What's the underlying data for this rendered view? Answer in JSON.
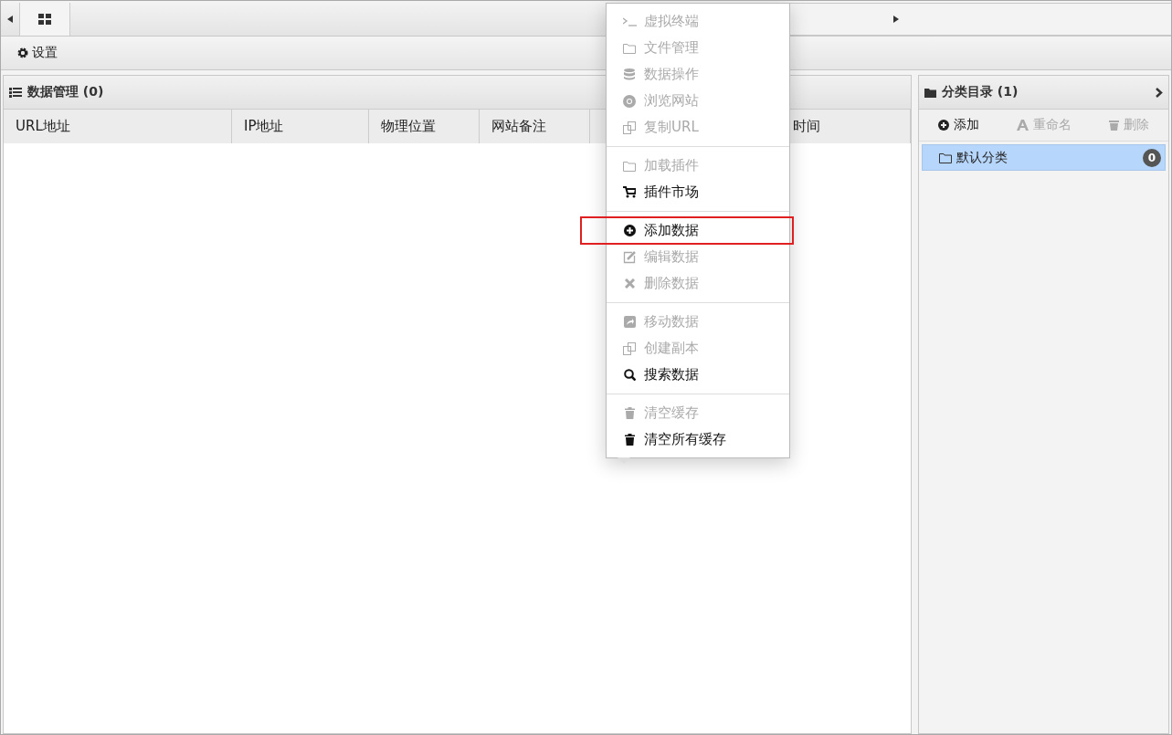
{
  "toolbar": {
    "settings_button": "设置"
  },
  "data_panel": {
    "title": "数据管理 (0)",
    "columns": [
      "URL地址",
      "IP地址",
      "物理位置",
      "网站备注",
      "时间"
    ]
  },
  "category_panel": {
    "title": "分类目录 (1)",
    "actions": [
      {
        "label": "添加",
        "disabled": false
      },
      {
        "label": "重命名",
        "disabled": true
      },
      {
        "label": "删除",
        "disabled": true
      }
    ],
    "items": [
      {
        "label": "默认分类",
        "count": "0",
        "selected": true
      }
    ]
  },
  "context_menu": [
    {
      "kind": "item",
      "label": "虚拟终端",
      "disabled": true,
      "highlighted": false
    },
    {
      "kind": "item",
      "label": "文件管理",
      "disabled": true,
      "highlighted": false
    },
    {
      "kind": "item",
      "label": "数据操作",
      "disabled": true,
      "highlighted": false
    },
    {
      "kind": "item",
      "label": "浏览网站",
      "disabled": true,
      "highlighted": false
    },
    {
      "kind": "item",
      "label": "复制URL",
      "disabled": true,
      "highlighted": false
    },
    {
      "kind": "separator"
    },
    {
      "kind": "item",
      "label": "加载插件",
      "disabled": true,
      "highlighted": false
    },
    {
      "kind": "item",
      "label": "插件市场",
      "disabled": false,
      "highlighted": false
    },
    {
      "kind": "separator"
    },
    {
      "kind": "item",
      "label": "添加数据",
      "disabled": false,
      "highlighted": true
    },
    {
      "kind": "item",
      "label": "编辑数据",
      "disabled": true,
      "highlighted": false
    },
    {
      "kind": "item",
      "label": "删除数据",
      "disabled": true,
      "highlighted": false
    },
    {
      "kind": "separator"
    },
    {
      "kind": "item",
      "label": "移动数据",
      "disabled": true,
      "highlighted": false
    },
    {
      "kind": "item",
      "label": "创建副本",
      "disabled": true,
      "highlighted": false
    },
    {
      "kind": "item",
      "label": "搜索数据",
      "disabled": false,
      "highlighted": false
    },
    {
      "kind": "separator"
    },
    {
      "kind": "item",
      "label": "清空缓存",
      "disabled": true,
      "highlighted": false
    },
    {
      "kind": "item",
      "label": "清空所有缓存",
      "disabled": false,
      "highlighted": false
    }
  ]
}
